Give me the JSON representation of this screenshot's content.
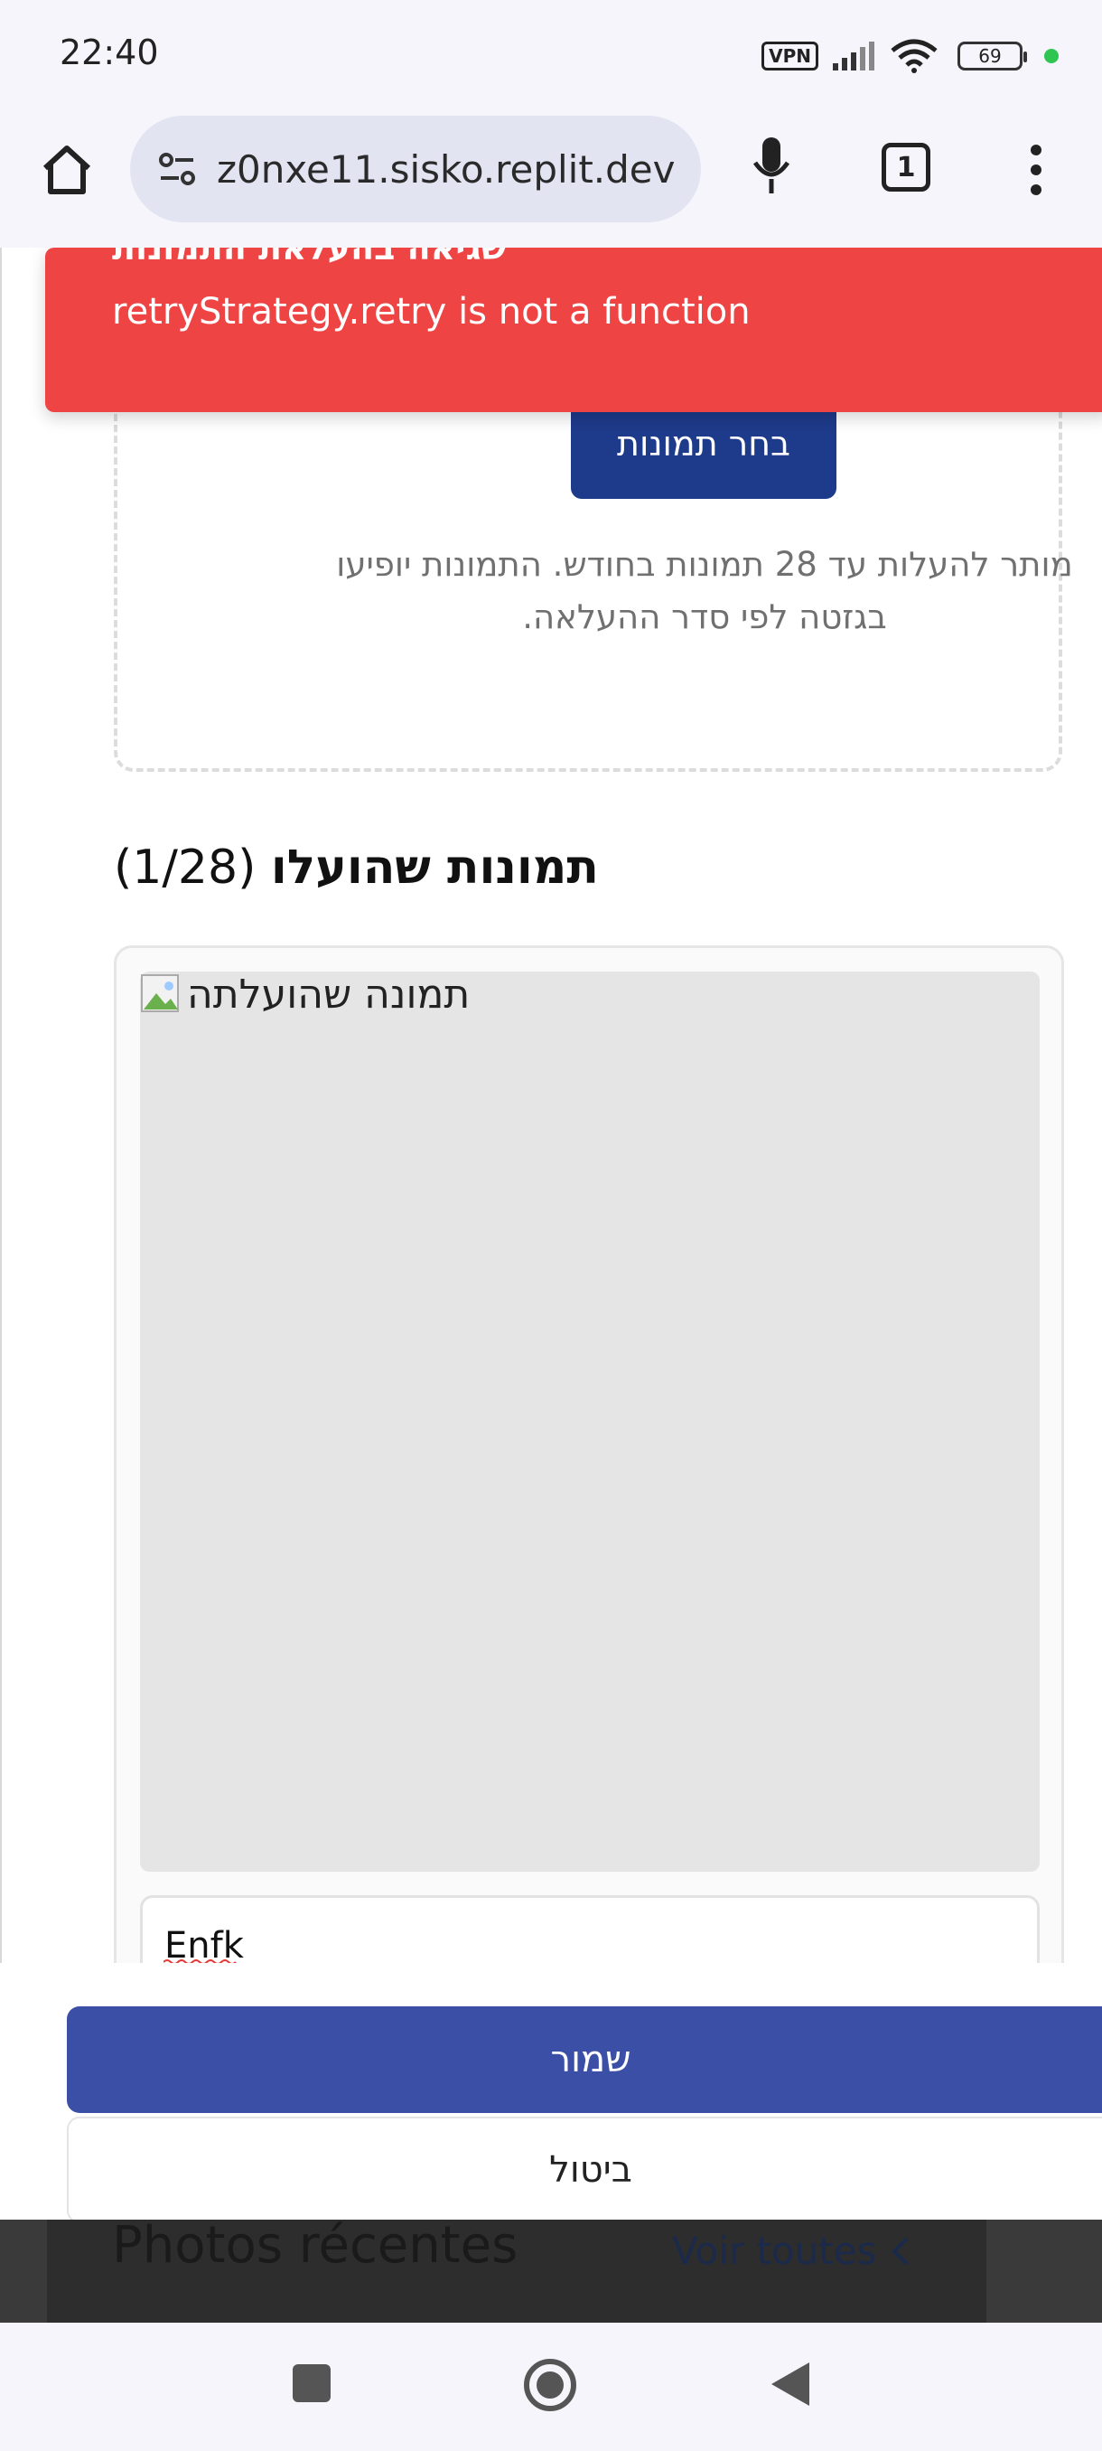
{
  "status_bar": {
    "time": "22:40",
    "vpn_label": "VPN",
    "battery_level": "69"
  },
  "browser": {
    "url": "z0nxe11.sisko.replit.dev",
    "tab_count": "1"
  },
  "error_toast": {
    "title": "שגיאה בהעלאת התמונות",
    "message": "retryStrategy.retry is not a function",
    "color": "#ef4444"
  },
  "upload": {
    "choose_button_label": "בחר תמונות",
    "note": "מותר להעלות עד 28 תמונות בחודש. התמונות יופיעו בגזטה לפי סדר ההעלאה."
  },
  "uploaded": {
    "title": "תמונות שהועלו",
    "count": "(1/28)",
    "image_alt": "תמונה שהועלתה",
    "caption_value": "Enfk"
  },
  "actions": {
    "save_label": "שמור",
    "cancel_label": "ביטול",
    "primary_color": "#3a4fa5"
  },
  "recent": {
    "title": "Photos récentes",
    "view_all": "Voir toutes"
  },
  "icons": {
    "home": "home-icon",
    "site_settings": "site-settings-icon",
    "mic": "microphone-icon",
    "tabs": "tabs-icon",
    "menu": "more-vert-icon",
    "nav_recents": "square-icon",
    "nav_home": "circle-icon",
    "nav_back": "triangle-back-icon"
  }
}
